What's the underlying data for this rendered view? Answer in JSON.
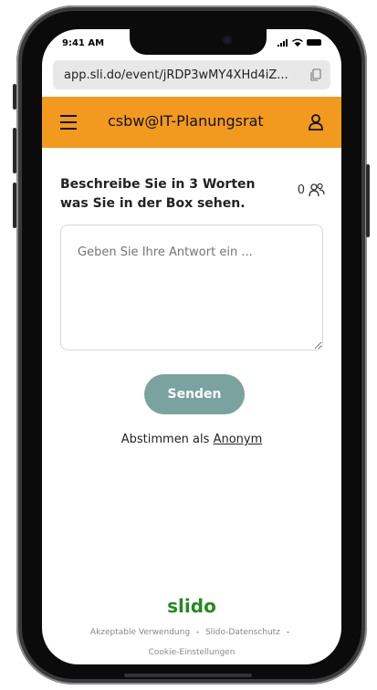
{
  "status": {
    "time": "9:41 AM"
  },
  "browser": {
    "url": "app.sli.do/event/jRDP3wMY4XHd4iZ..."
  },
  "header": {
    "title": "csbw@IT-Planungsrat"
  },
  "poll": {
    "question": "Beschreibe Sie in 3 Worten was Sie in der Box sehen.",
    "participant_count": "0",
    "answer_placeholder": "Geben Sie Ihre Antwort ein ...",
    "answer_value": "",
    "send_label": "Senden",
    "vote_as_prefix": "Abstimmen als",
    "vote_as_link": "Anonym"
  },
  "footer": {
    "brand": "slido",
    "links": [
      "Akzeptable Verwendung",
      "Slido-Datenschutz",
      "Cookie-Einstellungen"
    ],
    "separator": "-"
  },
  "colors": {
    "header": "#f29a1d",
    "send_button": "#7aa39f",
    "brand": "#228b22"
  },
  "icons": {
    "menu": "hamburger-menu-icon",
    "user": "user-icon",
    "participants": "participants-icon",
    "copy": "copy-icon"
  }
}
